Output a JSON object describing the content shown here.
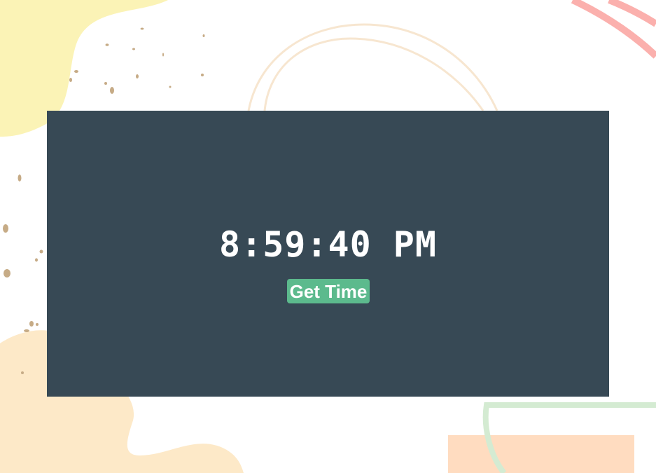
{
  "clock": {
    "time": "8:59:40 PM",
    "button_label": "Get Time"
  },
  "colors": {
    "panel": "#374955",
    "button": "#5cba8d",
    "text": "#ffffff"
  }
}
